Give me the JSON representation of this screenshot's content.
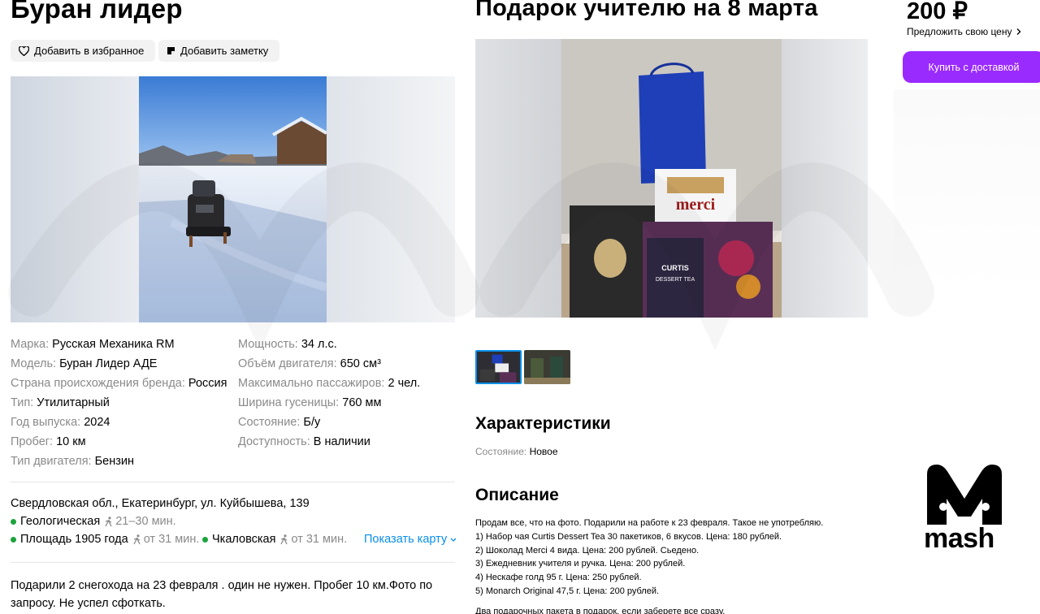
{
  "left": {
    "title": "Буран лидер",
    "fav_label": "Добавить в избранное",
    "note_label": "Добавить заметку",
    "specs_a": [
      {
        "k": "Марка:",
        "v": "Русская Механика RM"
      },
      {
        "k": "Модель:",
        "v": "Буран Лидер АДЕ"
      },
      {
        "k": "Страна происхождения бренда:",
        "v": "Россия"
      },
      {
        "k": "Тип:",
        "v": "Утилитарный"
      },
      {
        "k": "Год выпуска:",
        "v": "2024"
      },
      {
        "k": "Пробег:",
        "v": "10 км"
      },
      {
        "k": "Тип двигателя:",
        "v": "Бензин"
      }
    ],
    "specs_b": [
      {
        "k": "Мощность:",
        "v": "34 л.с."
      },
      {
        "k": "Объём двигателя:",
        "v": "650 см³"
      },
      {
        "k": "Максимально пассажиров:",
        "v": "2 чел."
      },
      {
        "k": "Ширина гусеницы:",
        "v": "760 мм"
      },
      {
        "k": "Состояние:",
        "v": "Б/у"
      },
      {
        "k": "Доступность:",
        "v": "В наличии"
      }
    ],
    "address": "Свердловская обл., Екатеринбург, ул. Куйбышева, 139",
    "metro": [
      {
        "name": "Геологическая",
        "time": "21–30 мин."
      },
      {
        "name": "Площадь 1905 года",
        "time": "от 31 мин."
      },
      {
        "name": "Чкаловская",
        "time": "от 31 мин."
      }
    ],
    "show_map": "Показать карту",
    "description": "Подарили 2 снегохода на 23 февраля . один не нужен. Пробег 10 км.Фото по запросу. Не успел сфоткать."
  },
  "mid": {
    "title": "Подарок учителю на 8 марта",
    "characteristics_heading": "Характеристики",
    "condition_key": "Состояние:",
    "condition_value": "Новое",
    "description_heading": "Описание",
    "description_lines": [
      "Продам все, что на фото. Подарили на работе к 23 февраля. Такое не употребляю.",
      "1) Набор чая Curtis Dessert Tea 30 пакетиков, 6 вкусов. Цена: 180 рублей.",
      "2) Шоколад Merci 4 вида. Цена: 200 рублей. Сьедено.",
      "3) Ежедневник учителя и ручка. Цена: 200 рублей.",
      "4) Нескафе голд 95 г. Цена: 250 рублей.",
      "5) Monarch Original 47,5 г. Цена: 200 рублей."
    ],
    "description_last": "Два подарочных пакета в подарок, если заберете все сразу.",
    "photo_labels": {
      "merci": "merci",
      "curtis": "CURTIS",
      "dessert": "DESSERT TEA"
    }
  },
  "right": {
    "price": "200 ₽",
    "offer_label": "Предложить свою цену",
    "buy_label": "Купить с доставкой",
    "logo_word": "mash"
  },
  "colors": {
    "accent_purple": "#9a2bff",
    "link_blue": "#0a8fe8",
    "metro_green": "#1ba33c"
  }
}
